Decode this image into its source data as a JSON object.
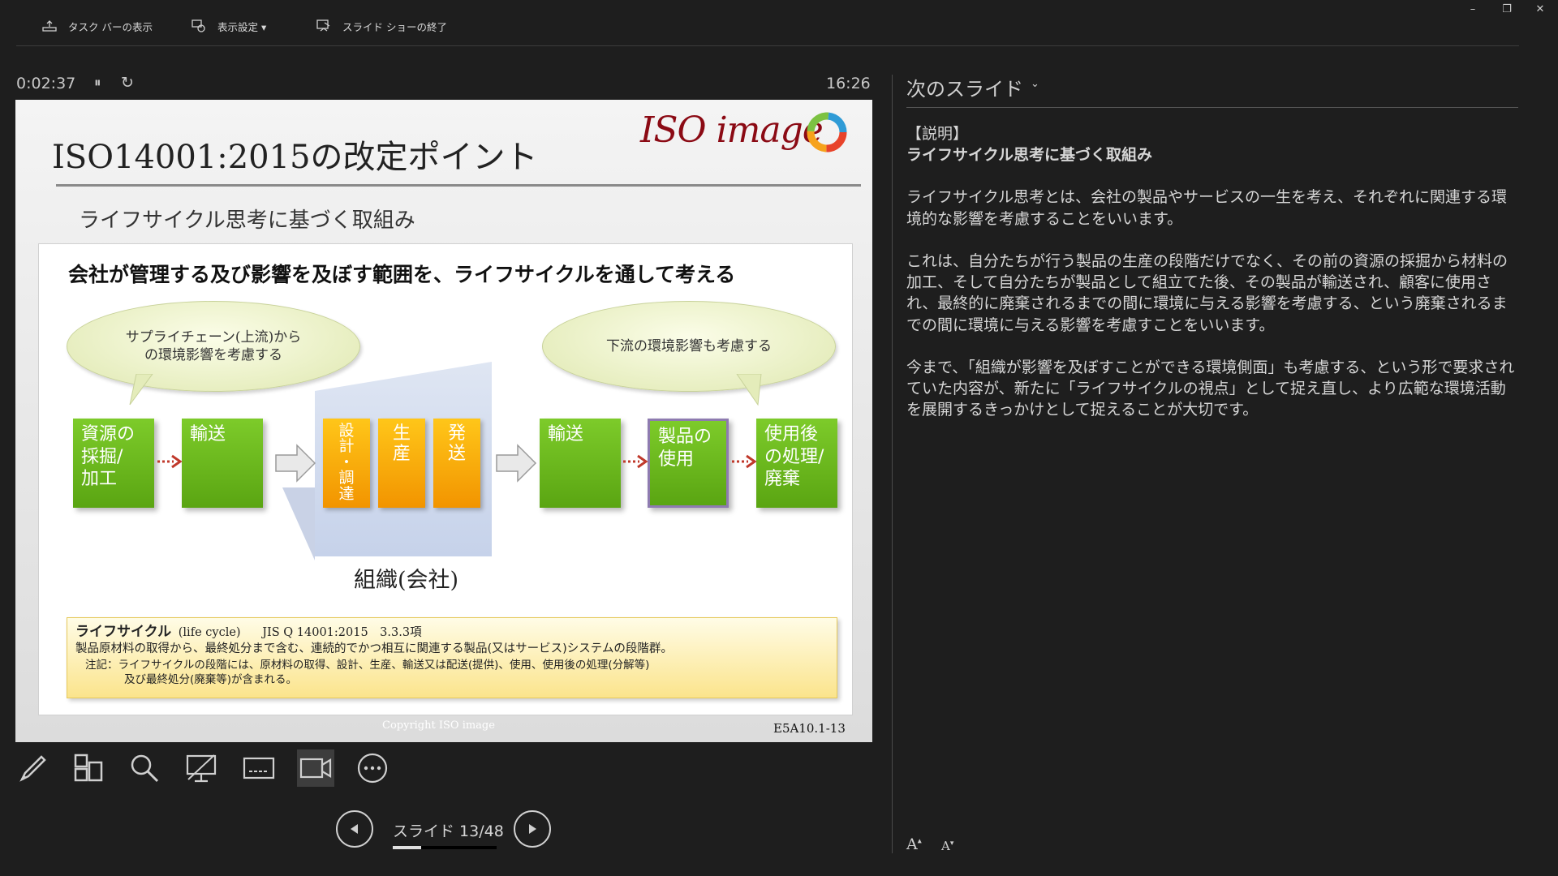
{
  "toolbar": {
    "taskbar_label": "タスク バーの表示",
    "display_label": "表示設定 ▾",
    "end_show_label": "スライド ショーの終了"
  },
  "window": {
    "minimize": "–",
    "restore": "❐",
    "close": "✕"
  },
  "timer": {
    "elapsed": "0:02:37",
    "pause_icon": "⏸",
    "reset_icon": "↻",
    "clock": "16:26"
  },
  "slide": {
    "title": "ISO14001:2015の改定ポイント",
    "logo": "ISO image",
    "subtitle": "ライフサイクル思考に基づく取組み",
    "headline": "会社が管理する及び影響を及ぼす範囲を、ライフサイクルを通して考える",
    "bubble_left": "サプライチェーン(上流)から\nの環境影響を考慮する",
    "bubble_right": "下流の環境影響も考慮する",
    "boxes": {
      "resource": "資源の\n採掘/\n加工",
      "transport1": "輸送",
      "design": "設\n計\n・\n調\n達",
      "production": "生\n産",
      "shipping": "発\n送",
      "transport2": "輸送",
      "use": "製品の\n使用",
      "disposal": "使用後\nの処理/\n廃棄"
    },
    "org_label": "組織(会社)",
    "definition": {
      "term": "ライフサイクル",
      "term_en": "(life cycle)",
      "ref": "JIS Q 14001:2015　3.3.3項",
      "line1": "製品原材料の取得から、最終処分まで含む、連続的でかつ相互に関連する製品(又はサービス)システムの段階群。",
      "note1": "注記：ライフサイクルの段階には、原材料の取得、設計、生産、輸送又は配送(提供)、使用、使用後の処理(分解等)",
      "note2": "及び最終処分(廃棄等)が含まれる。"
    },
    "copyright": "Copyright ISO image",
    "code": "E5A10.1-13"
  },
  "nav": {
    "slide_counter": "スライド 13/48",
    "current": 13,
    "total": 48
  },
  "next_panel": {
    "title": "次のスライド",
    "chevron": "⌄",
    "heading1": "【説明】",
    "heading2": "ライフサイクル思考に基づく取組み",
    "para1": "ライフサイクル思考とは、会社の製品やサービスの一生を考え、それぞれに関連する環境的な影響を考慮することをいいます。",
    "para2": "これは、自分たちが行う製品の生産の段階だけでなく、その前の資源の採掘から材料の加工、そして自分たちが製品として組立てた後、その製品が輸送され、顧客に使用され、最終的に廃棄されるまでの間に環境に与える影響を考慮する、という廃棄されるまでの間に環境に与える影響を考慮すことをいいます。",
    "para3": "今まで、「組織が影響を及ぼすことができる環境側面」も考慮する、という形で要求されていた内容が、新たに「ライフサイクルの視点」として捉え直し、より広範な環境活動を展開するきっかけとして捉えることが大切です。",
    "font_up": "A",
    "font_down": "A"
  }
}
